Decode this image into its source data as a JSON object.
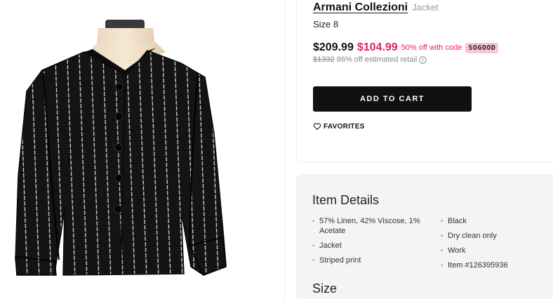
{
  "product": {
    "brand": "Armani Collezioni",
    "category": "Jacket",
    "size": "Size 8",
    "price_original": "$209.99",
    "price_sale": "$104.99",
    "promo_text": "50% off with code",
    "promo_code": "SOGOOD",
    "retail_price": "$1332",
    "retail_label": "86% off estimated retail",
    "add_to_cart": "ADD TO CART",
    "favorites": "FAVORITES"
  },
  "details": {
    "title": "Item Details",
    "left_items": [
      "57% Linen, 42% Viscose, 1% Acetate",
      "Jacket",
      "Striped print"
    ],
    "right_items": [
      "Black",
      "Dry clean only",
      "Work",
      "Item #126395936"
    ],
    "size_heading": "Size"
  },
  "colors": {
    "sale_red": "#e0245e",
    "promo_pink": "#f8c6dc",
    "button_black": "#111111",
    "details_bg": "#f4f4f4"
  },
  "icons": [
    "info-icon",
    "heart-icon"
  ]
}
